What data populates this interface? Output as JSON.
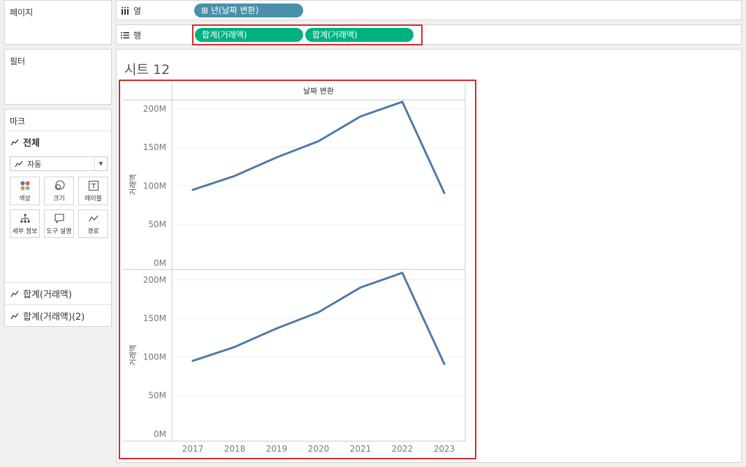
{
  "left_panel": {
    "pages_title": "페이지",
    "filters_title": "필터",
    "marks": {
      "title": "마크",
      "all_label": "전체",
      "mark_type": "자동",
      "buttons": [
        {
          "label": "색상",
          "icon": "color-icon"
        },
        {
          "label": "크기",
          "icon": "size-icon"
        },
        {
          "label": "레이블",
          "icon": "label-icon"
        },
        {
          "label": "세부 정보",
          "icon": "detail-icon"
        },
        {
          "label": "도구 설명",
          "icon": "tooltip-icon"
        },
        {
          "label": "경로",
          "icon": "path-icon"
        }
      ],
      "measures": [
        "합계(거래액)",
        "합계(거래액)(2)"
      ]
    }
  },
  "shelves": {
    "columns": {
      "label": "열",
      "pill": "년(날짜 변환)",
      "pill_icon": "⊞"
    },
    "rows": {
      "label": "행",
      "pills": [
        "합계(거래액)",
        "합계(거래액)"
      ]
    }
  },
  "sheet": {
    "title": "시트 12",
    "header": "날짜 변환",
    "line_color": "#4e79a7"
  },
  "chart_data": [
    {
      "type": "line",
      "ylabel": "거래액",
      "x": [
        "2017",
        "2018",
        "2019",
        "2020",
        "2021",
        "2022",
        "2023"
      ],
      "values": [
        95,
        113,
        137,
        158,
        190,
        209,
        91
      ],
      "unit": "M",
      "ylim": [
        0,
        220
      ],
      "yticks": [
        "0M",
        "50M",
        "100M",
        "150M",
        "200M"
      ]
    },
    {
      "type": "line",
      "ylabel": "거래액",
      "x": [
        "2017",
        "2018",
        "2019",
        "2020",
        "2021",
        "2022",
        "2023"
      ],
      "values": [
        95,
        113,
        137,
        158,
        190,
        209,
        91
      ],
      "unit": "M",
      "ylim": [
        0,
        220
      ],
      "yticks": [
        "0M",
        "50M",
        "100M",
        "150M",
        "200M"
      ]
    }
  ]
}
